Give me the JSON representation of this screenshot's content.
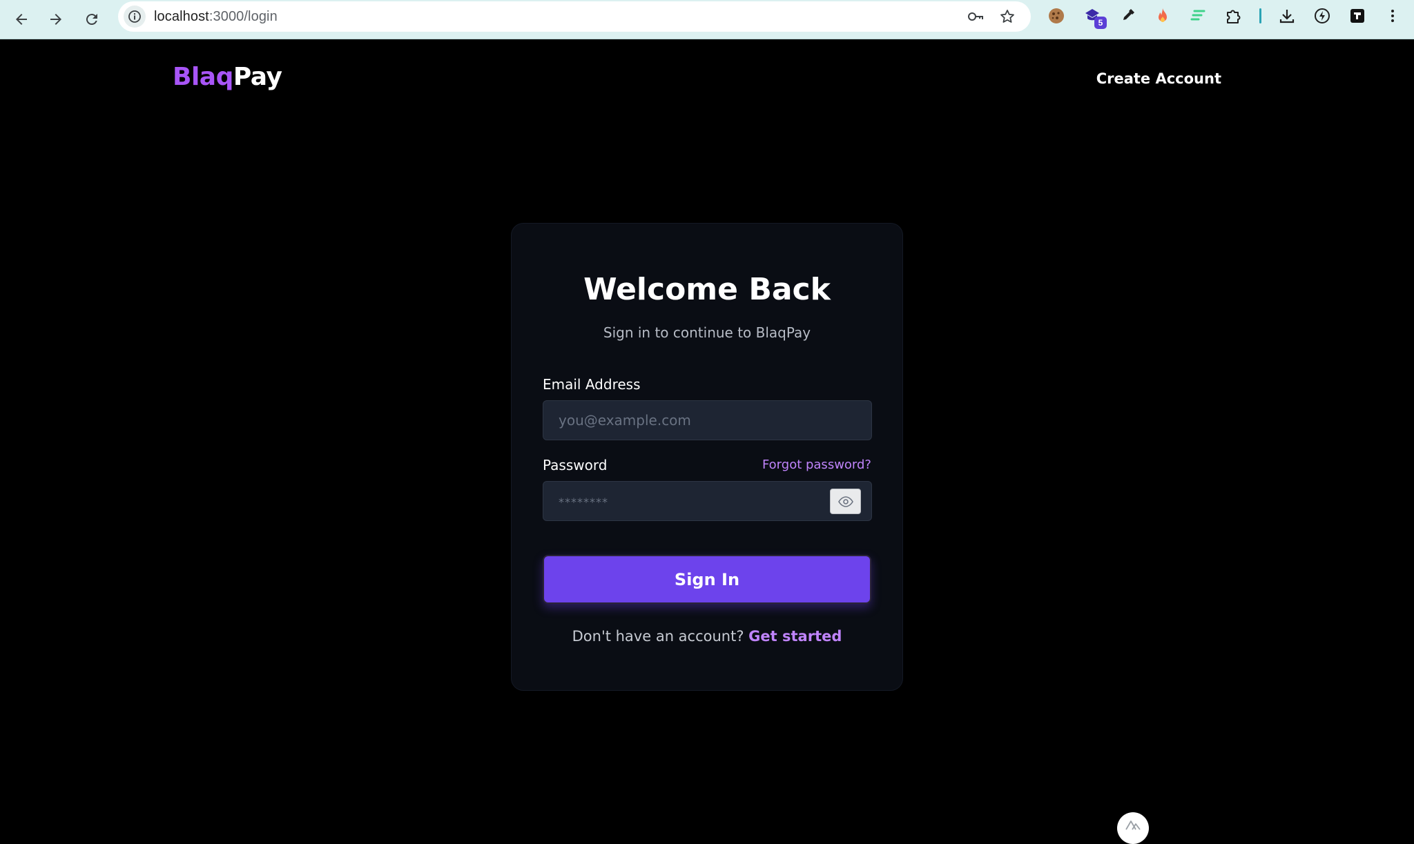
{
  "browser": {
    "url_host": "localhost",
    "url_path": ":3000/login",
    "extension_badge": "5"
  },
  "header": {
    "brand_part1": "Blaq",
    "brand_part2": "Pay",
    "create_account": "Create Account"
  },
  "login": {
    "title": "Welcome Back",
    "subtitle": "Sign in to continue to BlaqPay",
    "email_label": "Email Address",
    "email_placeholder": "you@example.com",
    "email_value": "",
    "password_label": "Password",
    "password_placeholder": "********",
    "password_value": "",
    "forgot_password": "Forgot password?",
    "sign_in_button": "Sign In",
    "no_account_text": "Don't have an account?",
    "get_started": "Get started"
  },
  "colors": {
    "brand_purple": "#a855f7",
    "button_purple": "#6d43ec",
    "link_purple": "#c084fc",
    "card_bg": "#0a0d14",
    "page_bg": "#000000"
  },
  "icons": [
    "back-icon",
    "forward-icon",
    "reload-icon",
    "site-info-icon",
    "key-icon",
    "star-icon",
    "cookie-extension-icon",
    "extension-icon",
    "eyedropper-icon",
    "fire-extension-icon",
    "extension-lines-icon",
    "puzzle-icon",
    "download-icon",
    "bolt-icon",
    "app-icon",
    "more-icon",
    "eye-icon",
    "nuxt-icon"
  ]
}
